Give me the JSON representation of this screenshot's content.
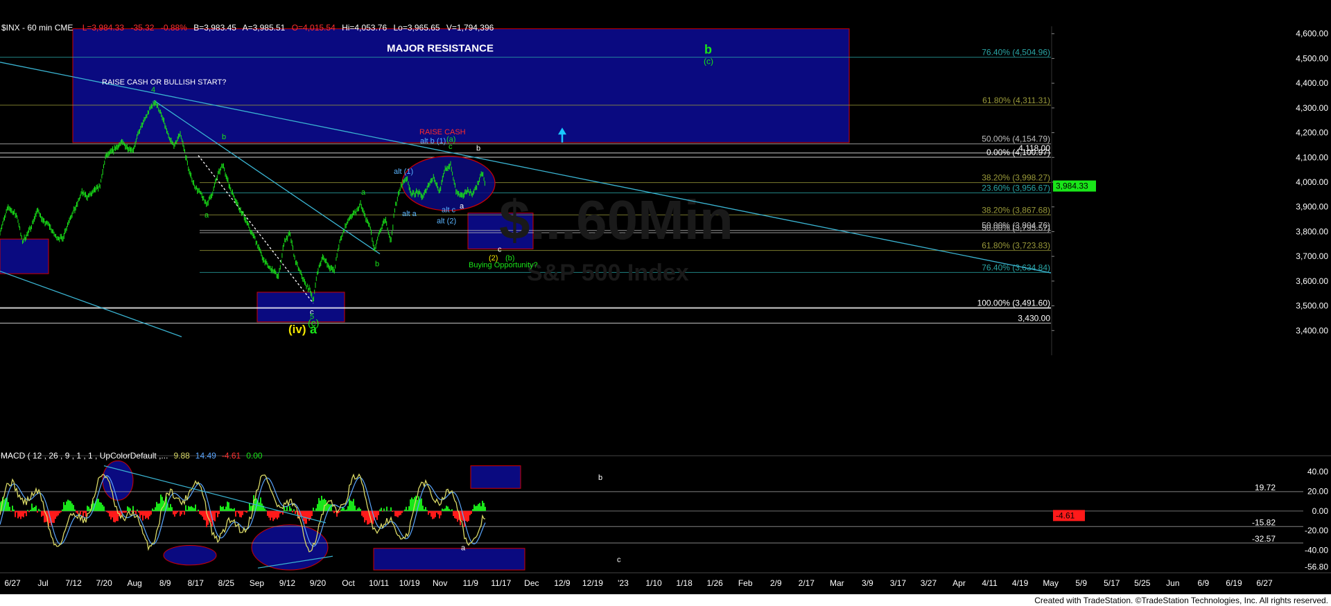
{
  "header": {
    "symbol": "$INX - 60 min  CME",
    "L": "L=3,984.33",
    "chg": "-35.32",
    "pct": "-0.88%",
    "B": "B=3,983.45",
    "A": "A=3,985.51",
    "O": "O=4,015.54",
    "Hi": "Hi=4,053.76",
    "Lo": "Lo=3,965.65",
    "V": "V=1,794,396"
  },
  "footer": {
    "credit": "Created with TradeStation. ©TradeStation Technologies, Inc. All rights reserved."
  },
  "watermark": {
    "line1": "$...60Min",
    "line2": "S&P 500 Index"
  },
  "colors": {
    "price": "#19e619",
    "box": "#0a0a80",
    "boxBorder": "#d00000",
    "cyanLine": "#3ab4d2",
    "white": "#ffffff",
    "fibCyan": "#2aa5a5",
    "fibOlive": "#9a9a3a",
    "up": "#19e619",
    "down": "#ff1a1a",
    "macdYellow": "#d9d966",
    "macdBlue": "#5aa6ff",
    "headerRed": "#ff3030",
    "headerWhite": "#ffffff"
  },
  "chart_data": {
    "type": "line",
    "title": "$INX - 60 min",
    "ylim": [
      3300,
      4630
    ],
    "yticks": [
      "4,600.00",
      "4,500.00",
      "4,400.00",
      "4,300.00",
      "4,200.00",
      "4,100.00",
      "4,000.00",
      "3,900.00",
      "3,800.00",
      "3,700.00",
      "3,600.00",
      "3,500.00",
      "3,400.00"
    ],
    "ytick_values": [
      4600,
      4500,
      4400,
      4300,
      4200,
      4100,
      4000,
      3900,
      3800,
      3700,
      3600,
      3500,
      3400
    ],
    "xticks": [
      "6/27",
      "Jul",
      "7/12",
      "7/20",
      "Aug",
      "8/9",
      "8/17",
      "8/25",
      "Sep",
      "9/12",
      "9/20",
      "Oct",
      "10/11",
      "10/19",
      "Nov",
      "11/9",
      "11/17",
      "Dec",
      "12/9",
      "12/19",
      "'23",
      "1/10",
      "1/18",
      "1/26",
      "Feb",
      "2/9",
      "2/17",
      "Mar",
      "3/9",
      "3/17",
      "3/27",
      "Apr",
      "4/11",
      "4/19",
      "May",
      "5/9",
      "5/17",
      "5/25",
      "Jun",
      "6/9",
      "6/19",
      "6/27"
    ],
    "last_price": "3,984.33",
    "last_value": 3984.33,
    "price_path": [
      {
        "t": 0,
        "v": 3800
      },
      {
        "t": 12,
        "v": 3900
      },
      {
        "t": 25,
        "v": 3860
      },
      {
        "t": 32,
        "v": 3760
      },
      {
        "t": 40,
        "v": 3790
      },
      {
        "t": 55,
        "v": 3890
      },
      {
        "t": 62,
        "v": 3840
      },
      {
        "t": 70,
        "v": 3830
      },
      {
        "t": 80,
        "v": 3780
      },
      {
        "t": 90,
        "v": 3770
      },
      {
        "t": 100,
        "v": 3850
      },
      {
        "t": 110,
        "v": 3900
      },
      {
        "t": 118,
        "v": 3960
      },
      {
        "t": 126,
        "v": 3940
      },
      {
        "t": 135,
        "v": 3960
      },
      {
        "t": 145,
        "v": 3990
      },
      {
        "t": 152,
        "v": 4100
      },
      {
        "t": 160,
        "v": 4120
      },
      {
        "t": 168,
        "v": 4140
      },
      {
        "t": 176,
        "v": 4160
      },
      {
        "t": 184,
        "v": 4140
      },
      {
        "t": 192,
        "v": 4130
      },
      {
        "t": 200,
        "v": 4200
      },
      {
        "t": 210,
        "v": 4260
      },
      {
        "t": 218,
        "v": 4305
      },
      {
        "t": 224,
        "v": 4325
      },
      {
        "t": 230,
        "v": 4290
      },
      {
        "t": 238,
        "v": 4230
      },
      {
        "t": 244,
        "v": 4175
      },
      {
        "t": 252,
        "v": 4145
      },
      {
        "t": 260,
        "v": 4200
      },
      {
        "t": 266,
        "v": 4130
      },
      {
        "t": 274,
        "v": 4030
      },
      {
        "t": 282,
        "v": 3980
      },
      {
        "t": 290,
        "v": 3950
      },
      {
        "t": 298,
        "v": 3910
      },
      {
        "t": 306,
        "v": 3950
      },
      {
        "t": 314,
        "v": 4030
      },
      {
        "t": 322,
        "v": 4070
      },
      {
        "t": 330,
        "v": 3990
      },
      {
        "t": 338,
        "v": 3940
      },
      {
        "t": 346,
        "v": 3890
      },
      {
        "t": 354,
        "v": 3850
      },
      {
        "t": 362,
        "v": 3800
      },
      {
        "t": 370,
        "v": 3760
      },
      {
        "t": 378,
        "v": 3700
      },
      {
        "t": 386,
        "v": 3660
      },
      {
        "t": 394,
        "v": 3640
      },
      {
        "t": 402,
        "v": 3620
      },
      {
        "t": 410,
        "v": 3760
      },
      {
        "t": 418,
        "v": 3790
      },
      {
        "t": 426,
        "v": 3680
      },
      {
        "t": 434,
        "v": 3630
      },
      {
        "t": 442,
        "v": 3580
      },
      {
        "t": 448,
        "v": 3560
      },
      {
        "t": 452,
        "v": 3520
      },
      {
        "t": 458,
        "v": 3640
      },
      {
        "t": 466,
        "v": 3700
      },
      {
        "t": 474,
        "v": 3660
      },
      {
        "t": 482,
        "v": 3640
      },
      {
        "t": 490,
        "v": 3760
      },
      {
        "t": 498,
        "v": 3820
      },
      {
        "t": 506,
        "v": 3860
      },
      {
        "t": 514,
        "v": 3880
      },
      {
        "t": 520,
        "v": 3910
      },
      {
        "t": 528,
        "v": 3850
      },
      {
        "t": 534,
        "v": 3820
      },
      {
        "t": 540,
        "v": 3720
      },
      {
        "t": 548,
        "v": 3800
      },
      {
        "t": 556,
        "v": 3850
      },
      {
        "t": 564,
        "v": 3760
      },
      {
        "t": 570,
        "v": 3900
      },
      {
        "t": 578,
        "v": 3980
      },
      {
        "t": 586,
        "v": 4020
      },
      {
        "t": 594,
        "v": 3950
      },
      {
        "t": 602,
        "v": 3960
      },
      {
        "t": 610,
        "v": 3940
      },
      {
        "t": 618,
        "v": 3990
      },
      {
        "t": 626,
        "v": 4020
      },
      {
        "t": 634,
        "v": 3960
      },
      {
        "t": 642,
        "v": 4050
      },
      {
        "t": 650,
        "v": 4070
      },
      {
        "t": 658,
        "v": 3960
      },
      {
        "t": 666,
        "v": 3940
      },
      {
        "t": 674,
        "v": 3970
      },
      {
        "t": 682,
        "v": 3950
      },
      {
        "t": 690,
        "v": 4000
      },
      {
        "t": 696,
        "v": 4040
      },
      {
        "t": 700,
        "v": 3984
      }
    ],
    "fib_levels": [
      {
        "label": "76.40% (4,504.96)",
        "value": 4504.96,
        "color": "#2aa5a5"
      },
      {
        "label": "61.80% (4,311.31)",
        "value": 4311.31,
        "color": "#9a9a3a"
      },
      {
        "label": "50.00% (4,154.79)",
        "value": 4154.79,
        "color": "#bfbfbf"
      },
      {
        "label": "4,118.00",
        "value": 4118.0,
        "color": "#ffffff"
      },
      {
        "label": "0.00% (4,100.97)",
        "value": 4100.97,
        "color": "#ffffff"
      },
      {
        "label": "38.20% (3,998.27)",
        "value": 3998.27,
        "color": "#9a9a3a"
      },
      {
        "label": "23.60% (3,956.67)",
        "value": 3956.67,
        "color": "#2aa5a5"
      },
      {
        "label": "38.20% (3,867.68)",
        "value": 3867.68,
        "color": "#9a9a3a"
      },
      {
        "label": "50.00% (3,804.76)",
        "value": 3804.76,
        "color": "#bfbfbf"
      },
      {
        "label": "50.00% (3,795.57)",
        "value": 3795.57,
        "color": "#bfbfbf"
      },
      {
        "label": "61.80% (3,723.83)",
        "value": 3723.83,
        "color": "#9a9a3a"
      },
      {
        "label": "76.40% (3,634.84)",
        "value": 3634.84,
        "color": "#2aa5a5"
      },
      {
        "label": "100.00% (3,491.60)",
        "value": 3491.6,
        "color": "#ffffff"
      },
      {
        "label": "3,430.00",
        "value": 3430.0,
        "color": "#ffffff"
      }
    ],
    "boxes": [
      {
        "name": "major-resistance-box",
        "x0": 105,
        "x1": 1225,
        "v0": 4620,
        "v1": 4160,
        "label": "MAJOR RESISTANCE"
      },
      {
        "name": "left-support-box",
        "x0": 0,
        "x1": 70,
        "v0": 3770,
        "v1": 3630
      },
      {
        "name": "october-low-box",
        "x0": 371,
        "x1": 497,
        "v0": 3555,
        "v1": 3435
      },
      {
        "name": "buying-opportunity-box",
        "x0": 675,
        "x1": 769,
        "v0": 3875,
        "v1": 3730
      }
    ],
    "annotations": [
      {
        "text": "RAISE CASH OR BULLISH START?",
        "x": 147,
        "v": 4395,
        "color": "#ffffff",
        "size": 11
      },
      {
        "text": "4",
        "x": 218,
        "v": 4364,
        "color": "#19e619",
        "size": 11
      },
      {
        "text": "b",
        "x": 320,
        "v": 4173,
        "color": "#19e619",
        "size": 11
      },
      {
        "text": "a",
        "x": 295,
        "v": 3857,
        "color": "#19e619",
        "size": 11
      },
      {
        "text": "a",
        "x": 521,
        "v": 3950,
        "color": "#19e619",
        "size": 11
      },
      {
        "text": "b",
        "x": 541,
        "v": 3660,
        "color": "#19e619",
        "size": 11
      },
      {
        "text": "c",
        "x": 447,
        "v": 3465,
        "color": "#ffffff",
        "size": 11
      },
      {
        "text": "5",
        "x": 447,
        "v": 3447,
        "color": "#19e619",
        "size": 11
      },
      {
        "text": "(c)",
        "x": 444,
        "v": 3418,
        "color": "#19e619",
        "size": 14
      },
      {
        "text": "(iv)",
        "x": 416,
        "v": 3390,
        "color": "#f2e600",
        "size": 17,
        "bold": true
      },
      {
        "text": "a",
        "x": 447,
        "v": 3388,
        "color": "#19e619",
        "size": 18,
        "bold": true
      },
      {
        "text": "RAISE CASH",
        "x": 605,
        "v": 4193,
        "color": "#ff2a2a",
        "size": 11
      },
      {
        "text": "alt b (1)",
        "x": 606,
        "v": 4157,
        "color": "#5ab4ff",
        "size": 11
      },
      {
        "text": "(a)",
        "x": 644,
        "v": 4164,
        "color": "#19e619",
        "size": 11
      },
      {
        "text": "c",
        "x": 647,
        "v": 4135,
        "color": "#19e619",
        "size": 11
      },
      {
        "text": "b",
        "x": 687,
        "v": 4128,
        "color": "#ffffff",
        "size": 11
      },
      {
        "text": "alt (1)",
        "x": 568,
        "v": 4033,
        "color": "#5ab4ff",
        "size": 11
      },
      {
        "text": "alt a",
        "x": 580,
        "v": 3863,
        "color": "#5ab4ff",
        "size": 11
      },
      {
        "text": "alt c",
        "x": 637,
        "v": 3878,
        "color": "#5ab4ff",
        "size": 11
      },
      {
        "text": "a",
        "x": 663,
        "v": 3893,
        "color": "#ffffff",
        "size": 11
      },
      {
        "text": "alt (2)",
        "x": 630,
        "v": 3833,
        "color": "#5ab4ff",
        "size": 11
      },
      {
        "text": "c",
        "x": 718,
        "v": 3719,
        "color": "#ffffff",
        "size": 11
      },
      {
        "text": "(2)",
        "x": 705,
        "v": 3683,
        "color": "#f2e600",
        "size": 11
      },
      {
        "text": "(b)",
        "x": 729,
        "v": 3683,
        "color": "#19e619",
        "size": 11
      },
      {
        "text": "Buying Opportunity?",
        "x": 676,
        "v": 3655,
        "color": "#19e619",
        "size": 11
      },
      {
        "text": "b",
        "x": 1016,
        "v": 4520,
        "color": "#19e619",
        "size": 18,
        "bold": true
      },
      {
        "text": "(c)",
        "x": 1015,
        "v": 4478,
        "color": "#19e619",
        "size": 12
      }
    ],
    "trendlines": [
      {
        "name": "long-downtrend-line",
        "x0": 0,
        "v0": 4485,
        "x1": 1516,
        "v1": 3633,
        "color": "#3ab4d2"
      },
      {
        "name": "lower-channel-line",
        "x0": 0,
        "v0": 3640,
        "x1": 262,
        "v1": 3375,
        "color": "#3ab4d2"
      },
      {
        "name": "inner-downtrend-line",
        "x0": 222,
        "v0": 4330,
        "x1": 548,
        "v1": 3710,
        "color": "#3ab4d2"
      },
      {
        "name": "dotted-decline-line",
        "x0": 286,
        "v0": 4108,
        "x1": 452,
        "v1": 3510,
        "color": "#ffffff",
        "dashed": true
      }
    ],
    "ellipses": [
      {
        "name": "december-top-ellipse",
        "cx": 647,
        "cv": 3995,
        "rx": 67,
        "rv": 110
      }
    ],
    "arrows": [
      {
        "name": "up-arrow",
        "x": 811,
        "v0": 4160,
        "v1": 4215,
        "color": "#19c8ff"
      }
    ],
    "macd": {
      "label": "MACD ( 12 , 26 , 9 , 1 , 1 , UpColorDefault ,...",
      "v1": "9.88",
      "v2": "14.49",
      "v3": "-4.61",
      "v4": "0.00",
      "ylim": [
        -60,
        52
      ],
      "yticks": [
        "40.00",
        "20.00",
        "0.00",
        "-20.00",
        "-40.00",
        "-56.80"
      ],
      "ytick_values": [
        40,
        20,
        0,
        -20,
        -40,
        -56.8
      ],
      "levels": [
        {
          "label": "19.72",
          "value": 19.72
        },
        {
          "label": "-15.82",
          "value": -15.82
        },
        {
          "label": "-32.57",
          "value": -32.57
        }
      ],
      "last_value": "-4.61",
      "last_num": -4.61,
      "boxes": [
        {
          "name": "macd-b-box",
          "x0": 679,
          "x1": 751,
          "v0": 46,
          "v1": 23,
          "label": "b"
        },
        {
          "name": "macd-c-box",
          "x0": 539,
          "x1": 757,
          "v0": -38,
          "v1": -60,
          "label": "c"
        }
      ],
      "ellipses": [
        {
          "name": "macd-aug-ellipse",
          "cx": 170,
          "cv": 31,
          "rx": 22,
          "rv": 20
        },
        {
          "name": "macd-sep-ellipse",
          "cx": 274,
          "cv": -45,
          "rx": 38,
          "rv": 10
        },
        {
          "name": "macd-oct-ellipse",
          "cx": 418,
          "cv": -37,
          "rx": 55,
          "rv": 23
        }
      ],
      "extra_labels": [
        {
          "text": "a",
          "x": 665,
          "v": -40,
          "color": "#ffffff"
        }
      ]
    }
  }
}
